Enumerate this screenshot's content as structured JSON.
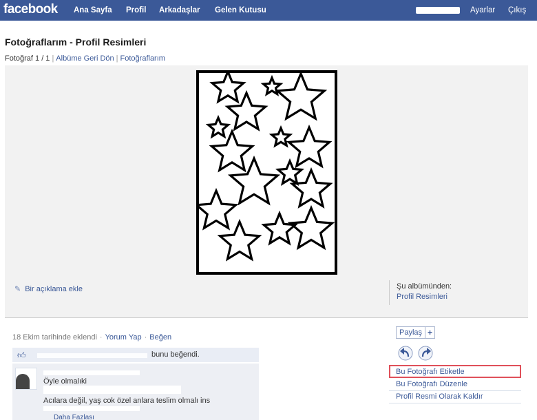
{
  "topbar": {
    "logo": "facebook",
    "nav": [
      "Ana Sayfa",
      "Profil",
      "Arkadaşlar",
      "Gelen Kutusu"
    ],
    "settings": "Ayarlar",
    "logout": "Çıkış"
  },
  "page": {
    "title": "Fotoğraflarım - Profil Resimleri",
    "position": "Fotoğraf 1 / 1",
    "back_link": "Albüme Geri Dön",
    "photos_link": "Fotoğraflarım"
  },
  "stage": {
    "add_caption": "Bir açıklama ekle",
    "album_from": "Şu albümünden:",
    "album_name": "Profil Resimleri"
  },
  "feedback": {
    "added": "18 Ekim tarihinde eklendi",
    "comment": "Yorum Yap",
    "like": "Beğen",
    "likes_text": "bunu beğendi.",
    "comment_line1": "Öyle olmalıki",
    "comment_line2": "Acılara değil, yaş cok özel anlara teslim olmalı ins",
    "more": "Daha Fazlası"
  },
  "actions": {
    "share": "Paylaş",
    "share_plus": "+",
    "tag": "Bu Fotoğrafı Etiketle",
    "edit": "Bu Fotoğrafı Düzenle",
    "remove": "Profil Resmi Olarak Kaldır"
  },
  "colors": {
    "brand": "#3b5998",
    "highlight": "#e0505a"
  },
  "icons": [
    "pencil-icon",
    "like-thumb-icon",
    "rotate-left-icon",
    "rotate-right-icon",
    "plus-icon",
    "star-icon"
  ]
}
